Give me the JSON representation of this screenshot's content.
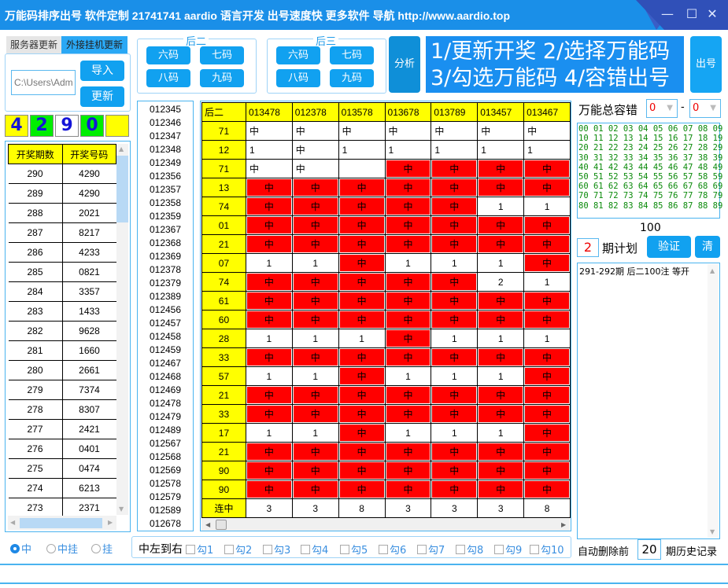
{
  "window": {
    "title": "万能码排序出号  软件定制 21741741 aardio 语言开发 出号速度快 更多软件 导航 http://www.aardio.top",
    "minimize": "—",
    "maximize": "☐",
    "close": "✕"
  },
  "update_tabs": {
    "tabs": [
      "服务器更新",
      "外接挂机更新"
    ],
    "active": "外接挂机更新",
    "path_value": "C:\\Users\\Adm",
    "import_label": "导入",
    "update_label": "更新"
  },
  "latest_digits": [
    "4",
    "2",
    "9",
    "0",
    ""
  ],
  "digit_colors": [
    "#ffff00",
    "#00ee00",
    "#ffffff",
    "#00ee00",
    "#ffff00"
  ],
  "history": {
    "headers": [
      "开奖期数",
      "开奖号码"
    ],
    "rows": [
      [
        "290",
        "4290"
      ],
      [
        "289",
        "4290"
      ],
      [
        "288",
        "2021"
      ],
      [
        "287",
        "8217"
      ],
      [
        "286",
        "4233"
      ],
      [
        "285",
        "0821"
      ],
      [
        "284",
        "3357"
      ],
      [
        "283",
        "1433"
      ],
      [
        "282",
        "9628"
      ],
      [
        "281",
        "1660"
      ],
      [
        "280",
        "2661"
      ],
      [
        "279",
        "7374"
      ],
      [
        "278",
        "8307"
      ],
      [
        "277",
        "2421"
      ],
      [
        "276",
        "0401"
      ],
      [
        "275",
        "0474"
      ],
      [
        "274",
        "6213"
      ],
      [
        "273",
        "2371"
      ]
    ]
  },
  "group_hou2": {
    "title": "后二",
    "buttons": [
      "六码",
      "七码",
      "八码",
      "九码"
    ]
  },
  "group_hou3": {
    "title": "后三",
    "buttons": [
      "六码",
      "七码",
      "八码",
      "九码"
    ]
  },
  "analyze_label": "分析",
  "banner": {
    "line1": "1/更新开奖  2/选择万能码",
    "line2": "3/勾选万能码  4/容错出号"
  },
  "output_label": "出号",
  "combo_list": [
    "012345",
    "012346",
    "012347",
    "012348",
    "012349",
    "012356",
    "012357",
    "012358",
    "012359",
    "012367",
    "012368",
    "012369",
    "012378",
    "012379",
    "012389",
    "012456",
    "012457",
    "012458",
    "012459",
    "012467",
    "012468",
    "012469",
    "012478",
    "012479",
    "012489",
    "012567",
    "012568",
    "012569",
    "012578",
    "012579",
    "012589",
    "012678"
  ],
  "grid": {
    "corner": "后二",
    "columns": [
      "013478",
      "012378",
      "013578",
      "013678",
      "013789",
      "013457",
      "013467"
    ],
    "rows": [
      {
        "label": "71",
        "cells": [
          [
            "中",
            0
          ],
          [
            "中",
            0
          ],
          [
            "中",
            0
          ],
          [
            "中",
            0
          ],
          [
            "中",
            0
          ],
          [
            "中",
            0
          ],
          [
            "中",
            0
          ]
        ],
        "left": true
      },
      {
        "label": "12",
        "cells": [
          [
            "1",
            0
          ],
          [
            "中",
            0
          ],
          [
            "1",
            0
          ],
          [
            "1",
            0
          ],
          [
            "1",
            0
          ],
          [
            "1",
            0
          ],
          [
            "1",
            0
          ]
        ],
        "left": true
      },
      {
        "label": "71",
        "cells": [
          [
            "中",
            0
          ],
          [
            "中",
            0
          ],
          [
            "",
            0
          ],
          [
            "中",
            1
          ],
          [
            "中",
            1
          ],
          [
            "中",
            1
          ],
          [
            "中",
            1
          ]
        ],
        "left": true
      },
      {
        "label": "13",
        "cells": [
          [
            "中",
            1
          ],
          [
            "中",
            1
          ],
          [
            "中",
            1
          ],
          [
            "中",
            1
          ],
          [
            "中",
            1
          ],
          [
            "中",
            1
          ],
          [
            "中",
            1
          ]
        ]
      },
      {
        "label": "74",
        "cells": [
          [
            "中",
            1
          ],
          [
            "中",
            1
          ],
          [
            "中",
            1
          ],
          [
            "中",
            1
          ],
          [
            "中",
            1
          ],
          [
            "1",
            0
          ],
          [
            "1",
            0
          ]
        ]
      },
      {
        "label": "01",
        "cells": [
          [
            "中",
            1
          ],
          [
            "中",
            1
          ],
          [
            "中",
            1
          ],
          [
            "中",
            1
          ],
          [
            "中",
            1
          ],
          [
            "中",
            1
          ],
          [
            "中",
            1
          ]
        ]
      },
      {
        "label": "21",
        "cells": [
          [
            "中",
            1
          ],
          [
            "中",
            1
          ],
          [
            "中",
            1
          ],
          [
            "中",
            1
          ],
          [
            "中",
            1
          ],
          [
            "中",
            1
          ],
          [
            "中",
            1
          ]
        ]
      },
      {
        "label": "07",
        "cells": [
          [
            "1",
            0
          ],
          [
            "1",
            0
          ],
          [
            "中",
            1
          ],
          [
            "1",
            0
          ],
          [
            "1",
            0
          ],
          [
            "1",
            0
          ],
          [
            "中",
            1
          ]
        ]
      },
      {
        "label": "74",
        "cells": [
          [
            "中",
            1
          ],
          [
            "中",
            1
          ],
          [
            "中",
            1
          ],
          [
            "中",
            1
          ],
          [
            "中",
            1
          ],
          [
            "2",
            0
          ],
          [
            "1",
            0
          ]
        ]
      },
      {
        "label": "61",
        "cells": [
          [
            "中",
            1
          ],
          [
            "中",
            1
          ],
          [
            "中",
            1
          ],
          [
            "中",
            1
          ],
          [
            "中",
            1
          ],
          [
            "中",
            1
          ],
          [
            "中",
            1
          ]
        ]
      },
      {
        "label": "60",
        "cells": [
          [
            "中",
            1
          ],
          [
            "中",
            1
          ],
          [
            "中",
            1
          ],
          [
            "中",
            1
          ],
          [
            "中",
            1
          ],
          [
            "中",
            1
          ],
          [
            "中",
            1
          ]
        ]
      },
      {
        "label": "28",
        "cells": [
          [
            "1",
            0
          ],
          [
            "1",
            0
          ],
          [
            "1",
            0
          ],
          [
            "中",
            1
          ],
          [
            "1",
            0
          ],
          [
            "1",
            0
          ],
          [
            "1",
            0
          ]
        ]
      },
      {
        "label": "33",
        "cells": [
          [
            "中",
            1
          ],
          [
            "中",
            1
          ],
          [
            "中",
            1
          ],
          [
            "中",
            1
          ],
          [
            "中",
            1
          ],
          [
            "中",
            1
          ],
          [
            "中",
            1
          ]
        ]
      },
      {
        "label": "57",
        "cells": [
          [
            "1",
            0
          ],
          [
            "1",
            0
          ],
          [
            "中",
            1
          ],
          [
            "1",
            0
          ],
          [
            "1",
            0
          ],
          [
            "1",
            0
          ],
          [
            "中",
            1
          ]
        ]
      },
      {
        "label": "21",
        "cells": [
          [
            "中",
            1
          ],
          [
            "中",
            1
          ],
          [
            "中",
            1
          ],
          [
            "中",
            1
          ],
          [
            "中",
            1
          ],
          [
            "中",
            1
          ],
          [
            "中",
            1
          ]
        ]
      },
      {
        "label": "33",
        "cells": [
          [
            "中",
            1
          ],
          [
            "中",
            1
          ],
          [
            "中",
            1
          ],
          [
            "中",
            1
          ],
          [
            "中",
            1
          ],
          [
            "中",
            1
          ],
          [
            "中",
            1
          ]
        ]
      },
      {
        "label": "17",
        "cells": [
          [
            "1",
            0
          ],
          [
            "1",
            0
          ],
          [
            "中",
            1
          ],
          [
            "1",
            0
          ],
          [
            "1",
            0
          ],
          [
            "1",
            0
          ],
          [
            "中",
            1
          ]
        ]
      },
      {
        "label": "21",
        "cells": [
          [
            "中",
            1
          ],
          [
            "中",
            1
          ],
          [
            "中",
            1
          ],
          [
            "中",
            1
          ],
          [
            "中",
            1
          ],
          [
            "中",
            1
          ],
          [
            "中",
            1
          ]
        ]
      },
      {
        "label": "90",
        "cells": [
          [
            "中",
            1
          ],
          [
            "中",
            1
          ],
          [
            "中",
            1
          ],
          [
            "中",
            1
          ],
          [
            "中",
            1
          ],
          [
            "中",
            1
          ],
          [
            "中",
            1
          ]
        ]
      },
      {
        "label": "90",
        "cells": [
          [
            "中",
            1
          ],
          [
            "中",
            1
          ],
          [
            "中",
            1
          ],
          [
            "中",
            1
          ],
          [
            "中",
            1
          ],
          [
            "中",
            1
          ],
          [
            "中",
            1
          ]
        ]
      },
      {
        "label": "连中",
        "cells": [
          [
            "3",
            0
          ],
          [
            "3",
            0
          ],
          [
            "8",
            0
          ],
          [
            "3",
            0
          ],
          [
            "3",
            0
          ],
          [
            "3",
            0
          ],
          [
            "8",
            0
          ]
        ]
      }
    ]
  },
  "tolerance": {
    "label": "万能总容错",
    "from": "0",
    "dash": "-",
    "to": "0"
  },
  "number_pool": [
    "00 01 02 03 04 05 06 07 08 09",
    "10 11 12 13 14 15 16 17 18 19",
    "20 21 22 23 24 25 26 27 28 29",
    "30 31 32 33 34 35 36 37 38 39",
    "40 41 42 43 44 45 46 47 48 49",
    "50 51 52 53 54 55 56 57 58 59",
    "60 61 62 63 64 65 66 67 68 69",
    "70 71 72 73 74 75 76 77 78 79",
    "80 81 82 83 84 85 86 87 88 89"
  ],
  "pool_count": "100",
  "plan": {
    "periods": "2",
    "label": "期计划",
    "verify_label": "验证",
    "clear_label": "清"
  },
  "log_text": "291-292期 后二100注 等开",
  "radios": {
    "options": [
      "中",
      "中挂",
      "挂"
    ],
    "selected": "中"
  },
  "checks": {
    "label": "中左到右",
    "items": [
      "勾1",
      "勾2",
      "勾3",
      "勾4",
      "勾5",
      "勾6",
      "勾7",
      "勾8",
      "勾9",
      "勾10"
    ]
  },
  "auto_delete": {
    "prefix": "自动删除前",
    "value": "20",
    "suffix": "期历史记录"
  },
  "colors": {
    "title_bar": "#1a8fe8",
    "accent": "#11a1f0",
    "hit_red": "#ff0000",
    "header_yellow": "#ffff00",
    "pool_green": "#0a8a0a"
  }
}
